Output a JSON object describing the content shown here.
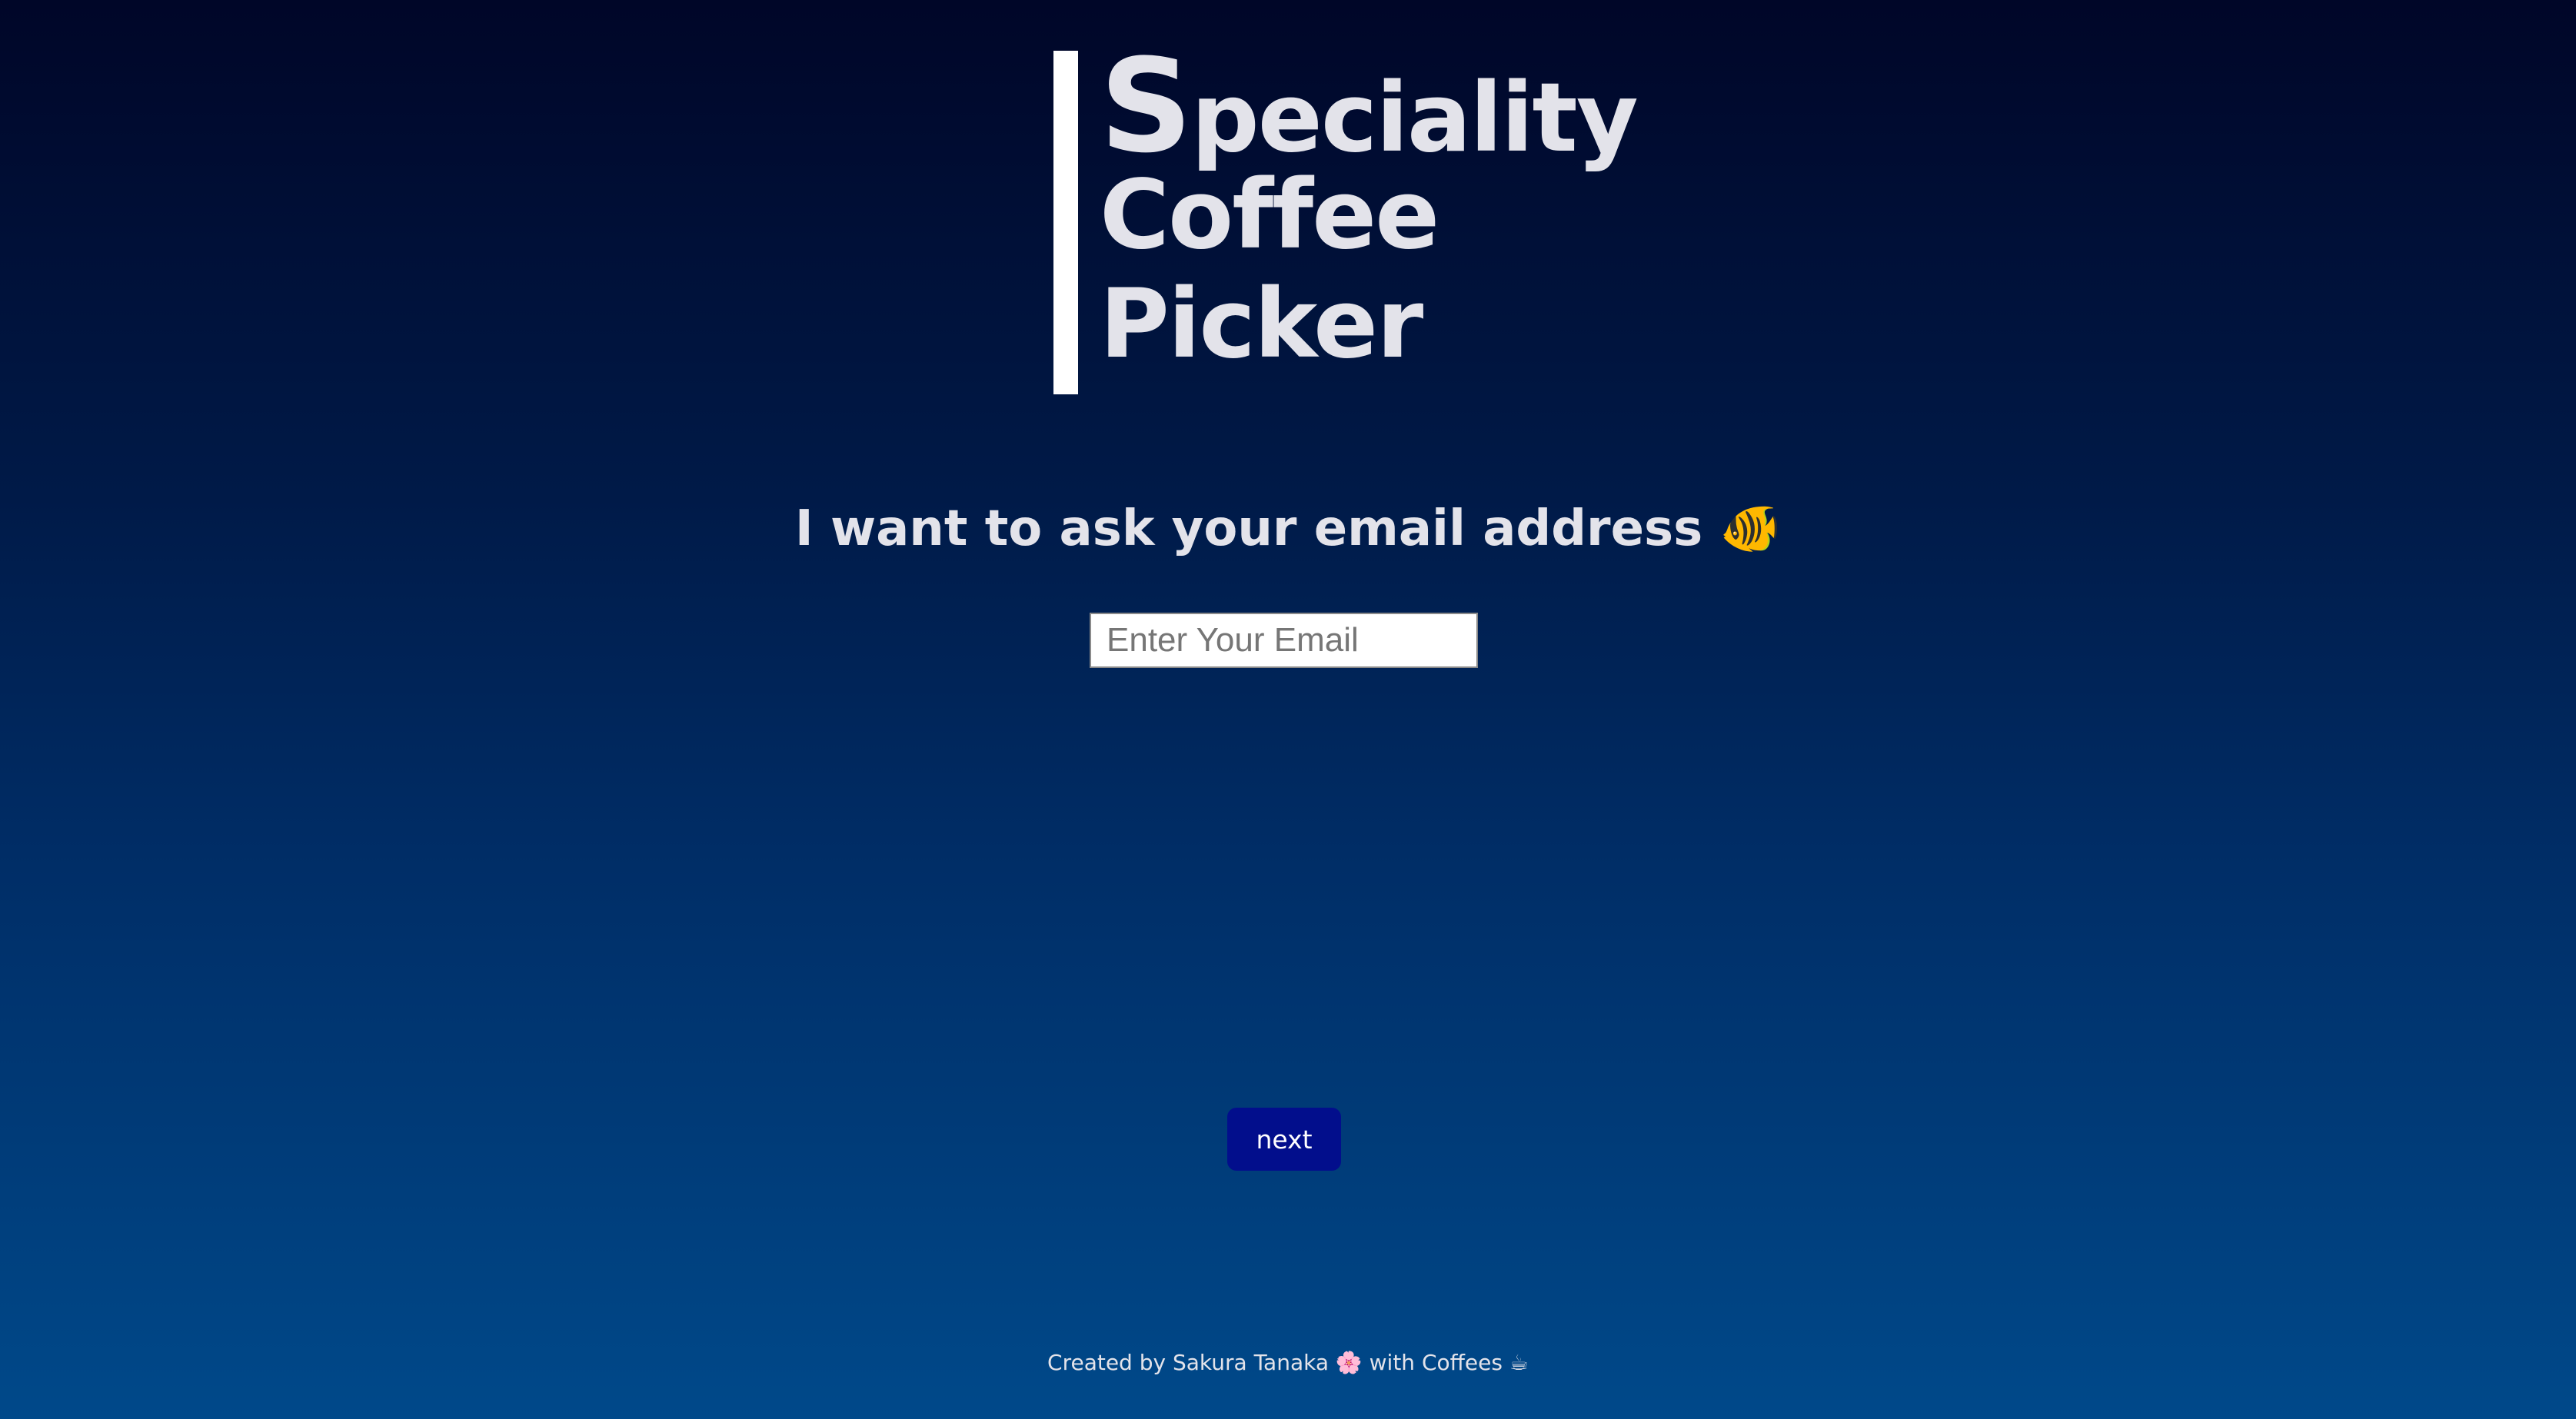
{
  "header": {
    "title_first_letter": "S",
    "title_line1_rest": "peciality",
    "title_line2": "Coffee",
    "title_line3": "Picker"
  },
  "form": {
    "question": "I want to ask your email address 🐠",
    "email_placeholder": "Enter Your Email",
    "email_value": "",
    "next_label": "next"
  },
  "footer": {
    "text": "Created by Sakura Tanaka 🌸 with Coffees ☕"
  },
  "colors": {
    "background_top": "#000628",
    "background_bottom": "#00498a",
    "title_text": "#e3e3ea",
    "accent_bar": "#ffffff",
    "button_bg": "#020e8c"
  }
}
